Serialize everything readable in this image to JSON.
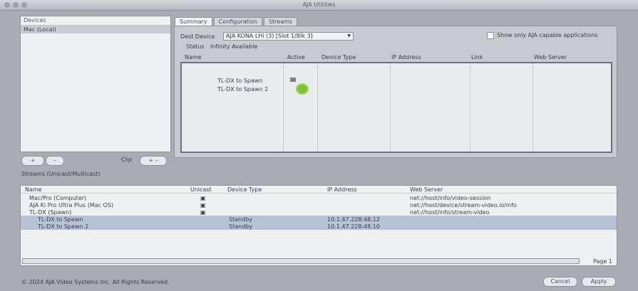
{
  "window": {
    "title": "AJA Utilities"
  },
  "left": {
    "list_header": "Devices",
    "list_selected": "Mac (Local)",
    "bottom_btn1": "+",
    "bottom_btn2": "–",
    "bottom_right_label": "Clip",
    "bottom_right_btn": "+ –"
  },
  "tabs": {
    "items": [
      "Summary",
      "Configuration",
      "Streams"
    ]
  },
  "right": {
    "device_label": "Dest Device",
    "device_value": "AJA KONA LHi (3) [Slot 1/Blk 3]",
    "status_label": "Status",
    "status_value": "Infinity Available",
    "checkbox_label": "Show only AJA capable applications",
    "table": {
      "columns": [
        "Name",
        "Active",
        "Device Type",
        "IP Address",
        "Link",
        "Web Server"
      ],
      "rows": [
        {
          "name": "TL-DX to Spawn"
        },
        {
          "name": "TL-DX to Spawn 2"
        }
      ]
    }
  },
  "section_label": "Streams (Unicast/Multicast)",
  "bottom": {
    "columns": [
      "Name",
      "Unicast",
      "Device Type",
      "IP Address",
      "Web Server"
    ],
    "rows": [
      {
        "name": "Mac/Pro (Computer)",
        "unicast": "▣",
        "type": "",
        "ip": "",
        "web": "net://host/info/video-session"
      },
      {
        "name": "AJA Ki Pro Ultra Plus (Mac OS)",
        "unicast": "▣",
        "type": "",
        "ip": "",
        "web": "net://host/device/stream-video.io/info"
      },
      {
        "name": "TL-DX (Spawn)",
        "unicast": "▣",
        "type": "",
        "ip": "",
        "web": "net://host/info/stream-video"
      },
      {
        "name": "TL-DX to Spawn",
        "unicast": "",
        "type": "Standby",
        "ip": "10.1.47.228:48.12",
        "web": ""
      },
      {
        "name": "TL-DX to Spawn 2",
        "unicast": "",
        "type": "Standby",
        "ip": "10.1.47.228:48.10",
        "web": ""
      }
    ],
    "page_label": "Page 1"
  },
  "footer": {
    "status": "© 2024 AJA Video Systems Inc. All Rights Reserved.",
    "cancel": "Cancel",
    "apply": "Apply"
  }
}
